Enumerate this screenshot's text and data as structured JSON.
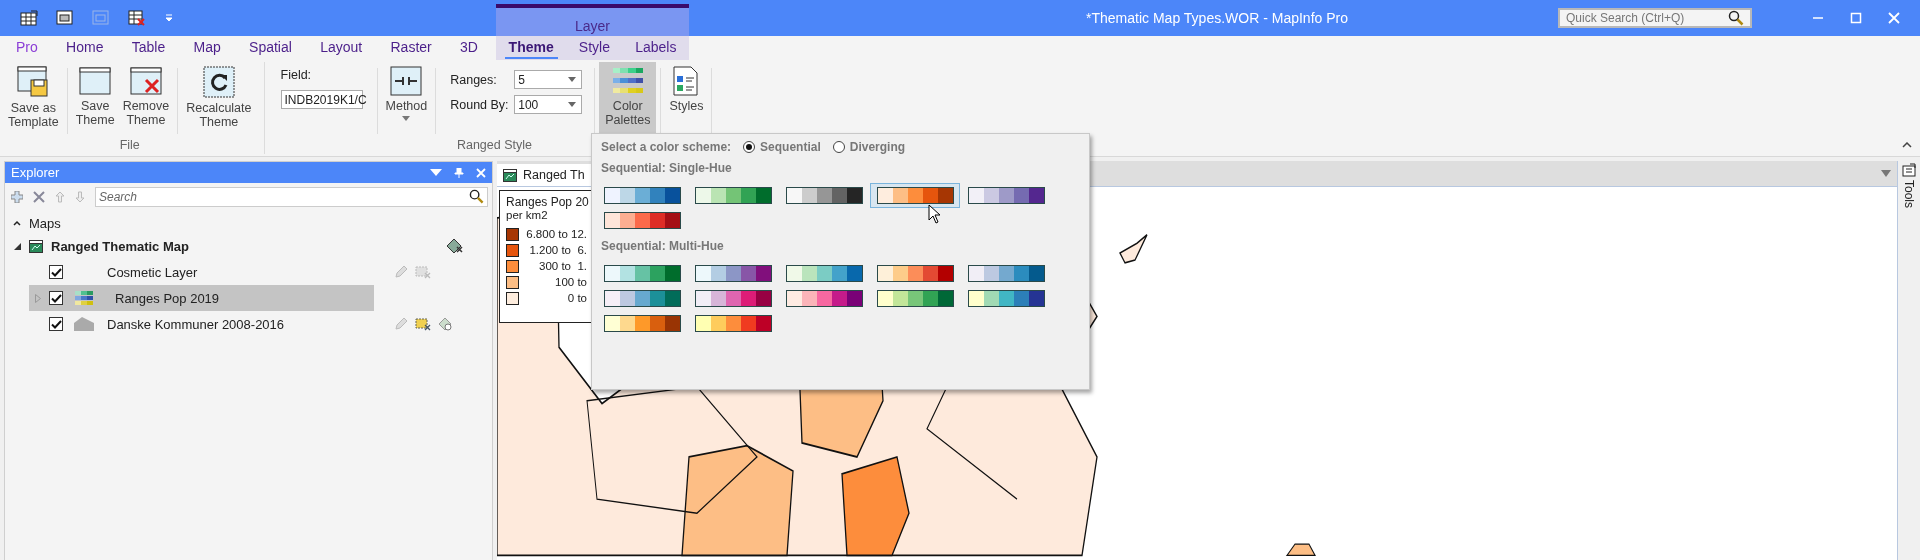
{
  "window": {
    "title": "*Thematic Map Types.WOR - MapInfo Pro"
  },
  "quick_search": {
    "placeholder": "Quick Search (Ctrl+Q)"
  },
  "ribbon": {
    "tabs": [
      {
        "label": "Pro",
        "kind": "backstage",
        "selected": false
      },
      {
        "label": "Home",
        "kind": "tab",
        "selected": false
      },
      {
        "label": "Table",
        "kind": "tab",
        "selected": false
      },
      {
        "label": "Map",
        "kind": "tab",
        "selected": false
      },
      {
        "label": "Spatial",
        "kind": "tab",
        "selected": false
      },
      {
        "label": "Layout",
        "kind": "tab",
        "selected": false
      },
      {
        "label": "Raster",
        "kind": "tab",
        "selected": false
      },
      {
        "label": "3D",
        "kind": "tab",
        "selected": false
      }
    ],
    "layer_group": {
      "label": "Layer",
      "tabs": [
        {
          "label": "Theme",
          "selected": true
        },
        {
          "label": "Style",
          "selected": false
        },
        {
          "label": "Labels",
          "selected": false
        }
      ]
    },
    "file_group": {
      "label": "File",
      "sections": [
        [
          {
            "label": "Save as\nTemplate",
            "kind": "template"
          }
        ],
        [
          {
            "label": "Save\nTheme",
            "kind": "save"
          },
          {
            "label": "Remove\nTheme",
            "kind": "remove"
          }
        ],
        [
          {
            "label": "Recalculate\nTheme",
            "kind": "recalculate"
          }
        ]
      ]
    },
    "ranged_style_group": {
      "label": "Ranged Style",
      "field": {
        "label": "Field:",
        "value": "INDB2019K1/C"
      },
      "method": {
        "label": "Method"
      },
      "ranges": {
        "label": "Ranges:",
        "value": "5"
      },
      "round_by": {
        "label": "Round By:",
        "value": "100"
      },
      "color_palettes": {
        "label": "Color\nPalettes",
        "pressed": true
      },
      "styles": {
        "label": "Styles"
      }
    }
  },
  "explorer": {
    "title": "Explorer",
    "search": {
      "placeholder": "Search"
    },
    "sections": [
      {
        "label": "Maps",
        "expanded": true,
        "maps": [
          {
            "label": "Ranged Thematic Map",
            "expanded": true,
            "layers": [
              {
                "label": "Cosmetic Layer",
                "kind": "cosmetic",
                "checked": true,
                "selected": false
              },
              {
                "label": "Ranges Pop 2019",
                "kind": "theme",
                "checked": true,
                "selected": true,
                "expanded": false
              },
              {
                "label": "Danske Kommuner 2008-2016",
                "kind": "region",
                "checked": true,
                "selected": false
              }
            ]
          }
        ]
      }
    ]
  },
  "map_window": {
    "tab": {
      "label": "Ranged Th"
    },
    "legend": {
      "title": "Ranges Pop 20",
      "subtitle": "per km2",
      "items": [
        {
          "color": "#a63603",
          "label": "6.800 to 12."
        },
        {
          "color": "#e6550d",
          "label": "1.200 to  6."
        },
        {
          "color": "#fd8d3c",
          "label": "300 to  1."
        },
        {
          "color": "#fdbe85",
          "label": "100 to"
        },
        {
          "color": "#feedde",
          "label": "0 to"
        }
      ]
    }
  },
  "tools_panel": {
    "label": "Tools"
  },
  "palette_popup": {
    "prompt": "Select a color scheme:",
    "schemes": [
      {
        "label": "Sequential",
        "selected": true
      },
      {
        "label": "Diverging",
        "selected": false
      }
    ],
    "groups": [
      {
        "title": "Sequential: Single-Hue",
        "palettes": [
          {
            "selected": false,
            "swatches": [
              {
                "color": "#eff3ff"
              },
              {
                "color": "#bdd7e7"
              },
              {
                "color": "#6baed6"
              },
              {
                "color": "#3182bd"
              },
              {
                "color": "#08519c"
              }
            ]
          },
          {
            "selected": false,
            "swatches": [
              {
                "color": "#edf8e9"
              },
              {
                "color": "#bae4b3"
              },
              {
                "color": "#74c476"
              },
              {
                "color": "#31a354"
              },
              {
                "color": "#006d2c"
              }
            ]
          },
          {
            "selected": false,
            "swatches": [
              {
                "color": "#f7f7f7"
              },
              {
                "color": "#cccccc"
              },
              {
                "color": "#969696"
              },
              {
                "color": "#636363"
              },
              {
                "color": "#252525"
              }
            ]
          },
          {
            "selected": true,
            "swatches": [
              {
                "color": "#feedde"
              },
              {
                "color": "#fdbe85"
              },
              {
                "color": "#fd8d3c"
              },
              {
                "color": "#e6550d"
              },
              {
                "color": "#a63603"
              }
            ]
          },
          {
            "selected": false,
            "swatches": [
              {
                "color": "#f2f0f7"
              },
              {
                "color": "#cbc9e2"
              },
              {
                "color": "#9e9ac8"
              },
              {
                "color": "#756bb1"
              },
              {
                "color": "#54278f"
              }
            ]
          },
          {
            "selected": false,
            "swatches": [
              {
                "color": "#fee5d9"
              },
              {
                "color": "#fcae91"
              },
              {
                "color": "#fb6a4a"
              },
              {
                "color": "#de2d26"
              },
              {
                "color": "#a50f15"
              }
            ]
          }
        ]
      },
      {
        "title": "Sequential: Multi-Hue",
        "palettes": [
          {
            "selected": false,
            "swatches": [
              {
                "color": "#edf8fb"
              },
              {
                "color": "#b2e2e2"
              },
              {
                "color": "#66c2a4"
              },
              {
                "color": "#2ca25f"
              },
              {
                "color": "#006d2c"
              }
            ]
          },
          {
            "selected": false,
            "swatches": [
              {
                "color": "#edf8fb"
              },
              {
                "color": "#b3cde3"
              },
              {
                "color": "#8c96c6"
              },
              {
                "color": "#8856a7"
              },
              {
                "color": "#810f7c"
              }
            ]
          },
          {
            "selected": false,
            "swatches": [
              {
                "color": "#f0f9e8"
              },
              {
                "color": "#bae4bc"
              },
              {
                "color": "#7bccc4"
              },
              {
                "color": "#43a2ca"
              },
              {
                "color": "#0868ac"
              }
            ]
          },
          {
            "selected": false,
            "swatches": [
              {
                "color": "#fef0d9"
              },
              {
                "color": "#fdcc8a"
              },
              {
                "color": "#fc8d59"
              },
              {
                "color": "#e34a33"
              },
              {
                "color": "#b30000"
              }
            ]
          },
          {
            "selected": false,
            "swatches": [
              {
                "color": "#f1eef6"
              },
              {
                "color": "#bdc9e1"
              },
              {
                "color": "#74a9cf"
              },
              {
                "color": "#2b8cbe"
              },
              {
                "color": "#045a8d"
              }
            ]
          },
          {
            "selected": false,
            "swatches": [
              {
                "color": "#f6eff7"
              },
              {
                "color": "#bdc9e1"
              },
              {
                "color": "#67a9cf"
              },
              {
                "color": "#1c9099"
              },
              {
                "color": "#016c59"
              }
            ]
          },
          {
            "selected": false,
            "swatches": [
              {
                "color": "#f1eef6"
              },
              {
                "color": "#d7b5d8"
              },
              {
                "color": "#df65b0"
              },
              {
                "color": "#dd1c77"
              },
              {
                "color": "#980043"
              }
            ]
          },
          {
            "selected": false,
            "swatches": [
              {
                "color": "#feebe2"
              },
              {
                "color": "#fbb4b9"
              },
              {
                "color": "#f768a1"
              },
              {
                "color": "#c51b8a"
              },
              {
                "color": "#7a0177"
              }
            ]
          },
          {
            "selected": false,
            "swatches": [
              {
                "color": "#ffffcc"
              },
              {
                "color": "#c2e699"
              },
              {
                "color": "#78c679"
              },
              {
                "color": "#31a354"
              },
              {
                "color": "#006837"
              }
            ]
          },
          {
            "selected": false,
            "swatches": [
              {
                "color": "#ffffcc"
              },
              {
                "color": "#a1dab4"
              },
              {
                "color": "#41b6c4"
              },
              {
                "color": "#2c7fb8"
              },
              {
                "color": "#253494"
              }
            ]
          },
          {
            "selected": false,
            "swatches": [
              {
                "color": "#ffffd4"
              },
              {
                "color": "#fed98e"
              },
              {
                "color": "#fe9929"
              },
              {
                "color": "#d95f0e"
              },
              {
                "color": "#993404"
              }
            ]
          },
          {
            "selected": false,
            "swatches": [
              {
                "color": "#ffffb2"
              },
              {
                "color": "#fecc5c"
              },
              {
                "color": "#fd8d3c"
              },
              {
                "color": "#f03b20"
              },
              {
                "color": "#bd0026"
              }
            ]
          }
        ]
      }
    ]
  }
}
